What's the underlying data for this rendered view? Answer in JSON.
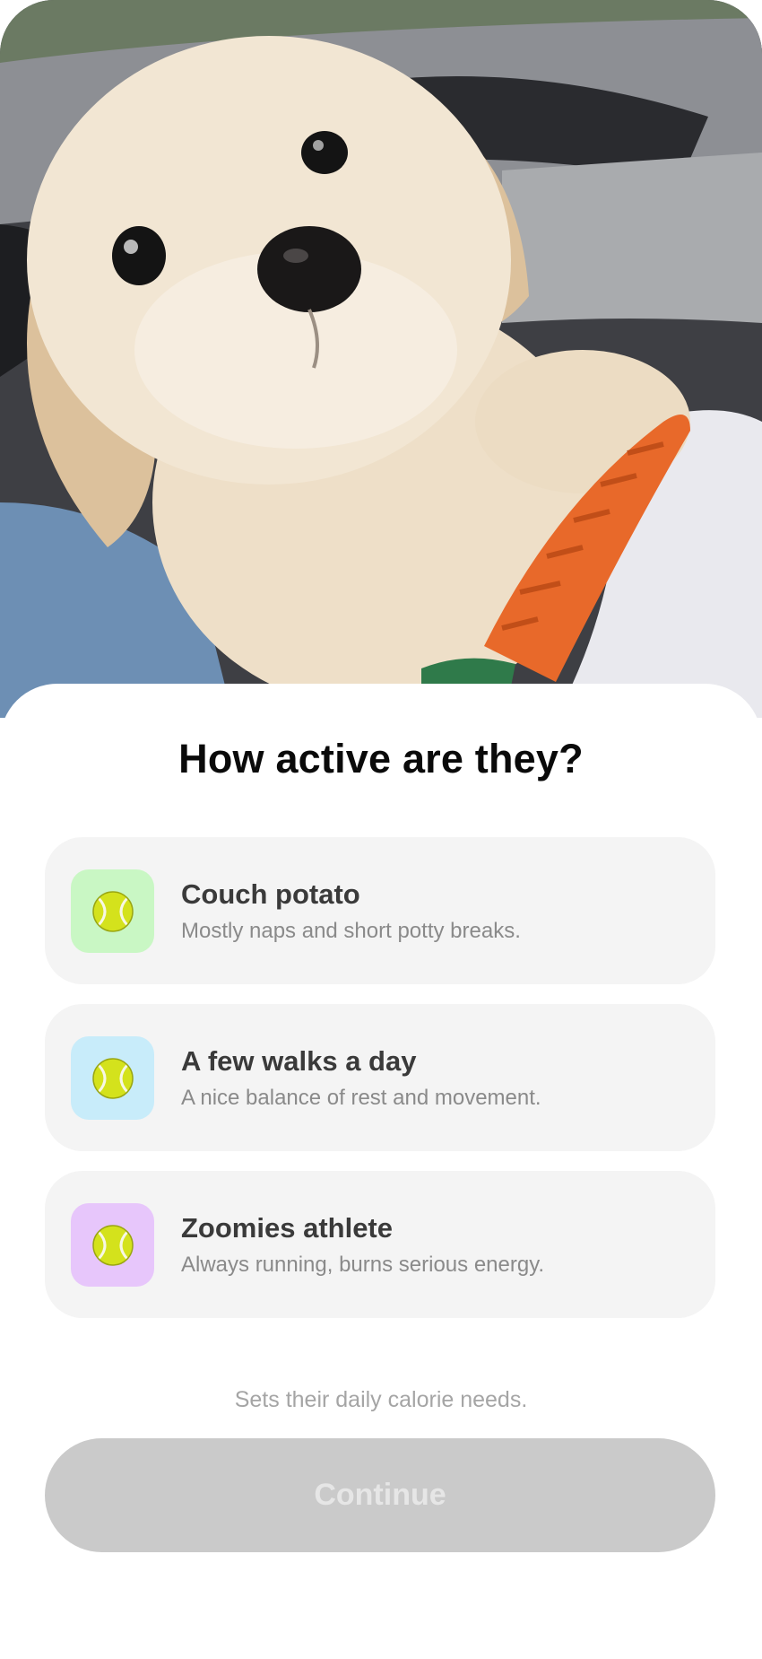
{
  "title": "How active are they?",
  "options": [
    {
      "title": "Couch potato",
      "description": "Mostly naps and short potty breaks.",
      "icon": "tennis-ball-icon",
      "tile_color": "#c9f7c4"
    },
    {
      "title": "A few walks a day",
      "description": "A nice balance of rest and movement.",
      "icon": "tennis-ball-icon",
      "tile_color": "#c8ecfa"
    },
    {
      "title": "Zoomies athlete",
      "description": "Always running, burns serious energy.",
      "icon": "tennis-ball-icon",
      "tile_color": "#e7c6fb"
    }
  ],
  "hint": "Sets their daily calorie needs.",
  "continue_label": "Continue",
  "continue_enabled": false,
  "hero_image": "puppy-photo"
}
